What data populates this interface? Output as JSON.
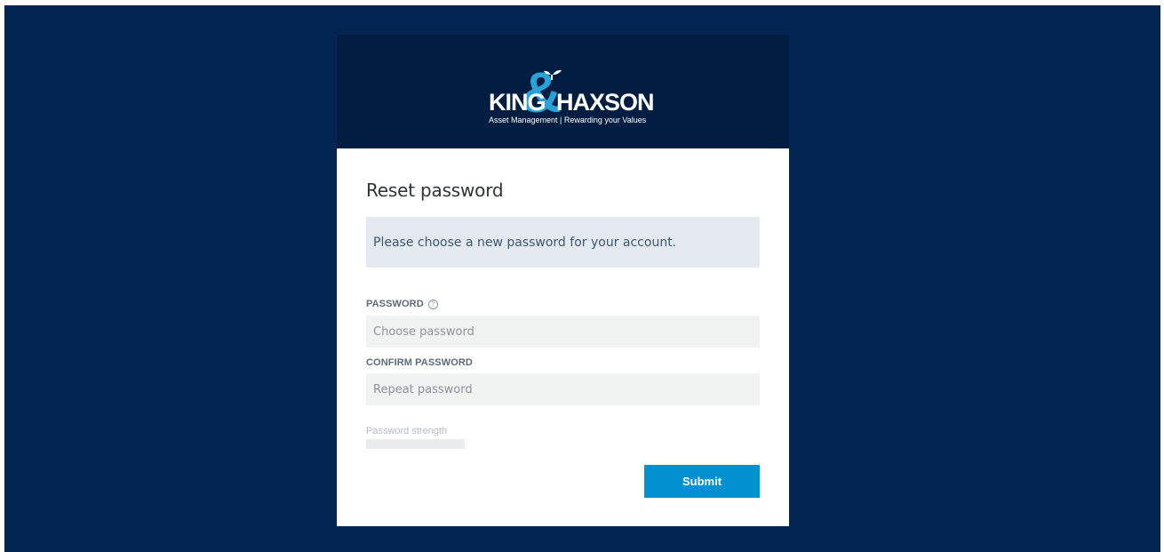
{
  "brand": {
    "name_left": "KING",
    "name_right": "HAXSON",
    "tagline": "Asset Management | Rewarding your Values"
  },
  "form": {
    "title": "Reset password",
    "notice": "Please choose a new password for your account.",
    "password_label": "PASSWORD",
    "password_help_icon": "?",
    "password_placeholder": "Choose password",
    "confirm_label": "CONFIRM PASSWORD",
    "confirm_placeholder": "Repeat password",
    "strength_label": "Password strength",
    "strength_value": 0,
    "submit_label": "Submit"
  },
  "colors": {
    "page_background": "#012450",
    "header_background": "#011e42",
    "accent": "#0191d1",
    "logo_ampersand": "#27a3d8"
  }
}
